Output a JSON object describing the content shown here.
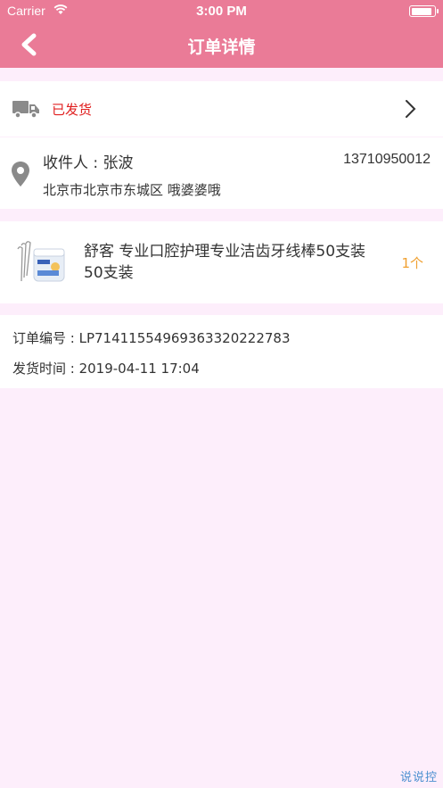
{
  "status_bar": {
    "carrier": "Carrier",
    "time": "3:00 PM"
  },
  "nav": {
    "title": "订单详情"
  },
  "shipping": {
    "status": "已发货",
    "status_color": "#e02020"
  },
  "address": {
    "recipient": "收件人 : 张波",
    "phone": "13710950012",
    "detail": "北京市北京市东城区 哦婆婆哦"
  },
  "product": {
    "name": "舒客 专业口腔护理专业洁齿牙线棒50支装 50支装",
    "quantity": "1个"
  },
  "order_info": {
    "order_number": "订单编号 : LP714115549693633202227​83",
    "ship_time": "发货时间 : 2019-04-11 17:04"
  },
  "watermark": "说说控",
  "colors": {
    "header": "#ea7b97",
    "background": "#fdeefb",
    "accent_qty": "#f0a030"
  }
}
